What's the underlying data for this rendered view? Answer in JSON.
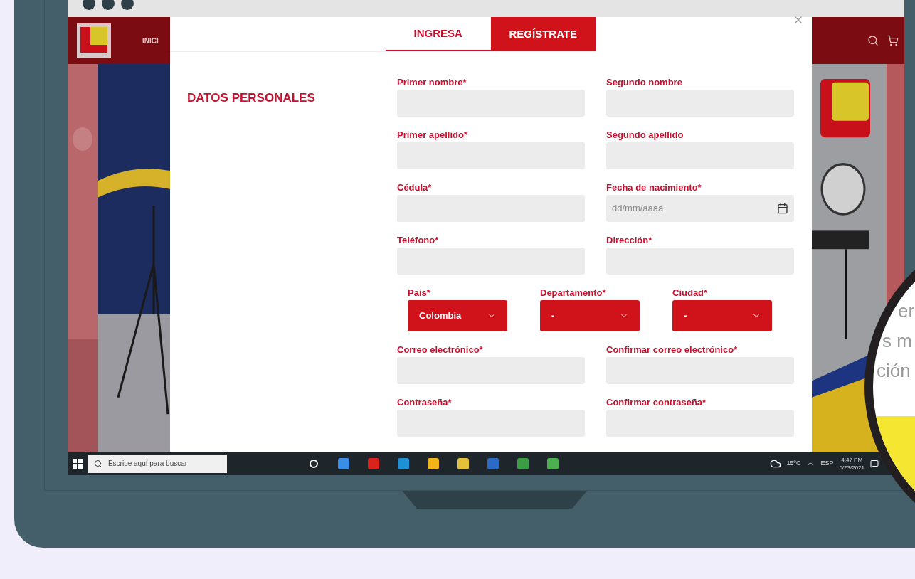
{
  "site": {
    "nav": [
      "INICI"
    ]
  },
  "modal": {
    "tabs": [
      {
        "label": "INGRESA",
        "selected": false
      },
      {
        "label": "REGÍSTRATE",
        "selected": true
      }
    ],
    "section_title": "DATOS PERSONALES",
    "rows": [
      {
        "kind": "inputs",
        "fields": [
          {
            "label": "Primer nombre*"
          },
          {
            "label": "Segundo nombre"
          }
        ]
      },
      {
        "kind": "inputs",
        "fields": [
          {
            "label": "Primer apellido*"
          },
          {
            "label": "Segundo apellido"
          }
        ]
      },
      {
        "kind": "inputs",
        "fields": [
          {
            "label": "Cédula*"
          },
          {
            "label": "Fecha de nacimiento*",
            "kind": "date",
            "placeholder": "dd/mm/aaaa"
          }
        ]
      },
      {
        "kind": "inputs",
        "fields": [
          {
            "label": "Teléfono*"
          },
          {
            "label": "Dirección*"
          }
        ]
      },
      {
        "kind": "selects",
        "fields": [
          {
            "label": "Pais*",
            "value": "Colombia"
          },
          {
            "label": "Departamento*",
            "value": "-"
          },
          {
            "label": "Ciudad*",
            "value": "-"
          }
        ]
      },
      {
        "kind": "inputs",
        "fields": [
          {
            "label": "Correo electrónico*"
          },
          {
            "label": "Confirmar correo electrónico*"
          }
        ]
      },
      {
        "kind": "inputs",
        "fields": [
          {
            "label": "Contraseña*"
          },
          {
            "label": "Confirmar contraseña*"
          }
        ]
      }
    ]
  },
  "taskbar": {
    "search_placeholder": "Escribe aquí para buscar",
    "weather": "15ºC",
    "language": "ESP",
    "time": "4:47 PM",
    "date": "6/23/2021"
  },
  "magnifier": {
    "lines": [
      "er",
      "s m",
      "ción"
    ]
  }
}
